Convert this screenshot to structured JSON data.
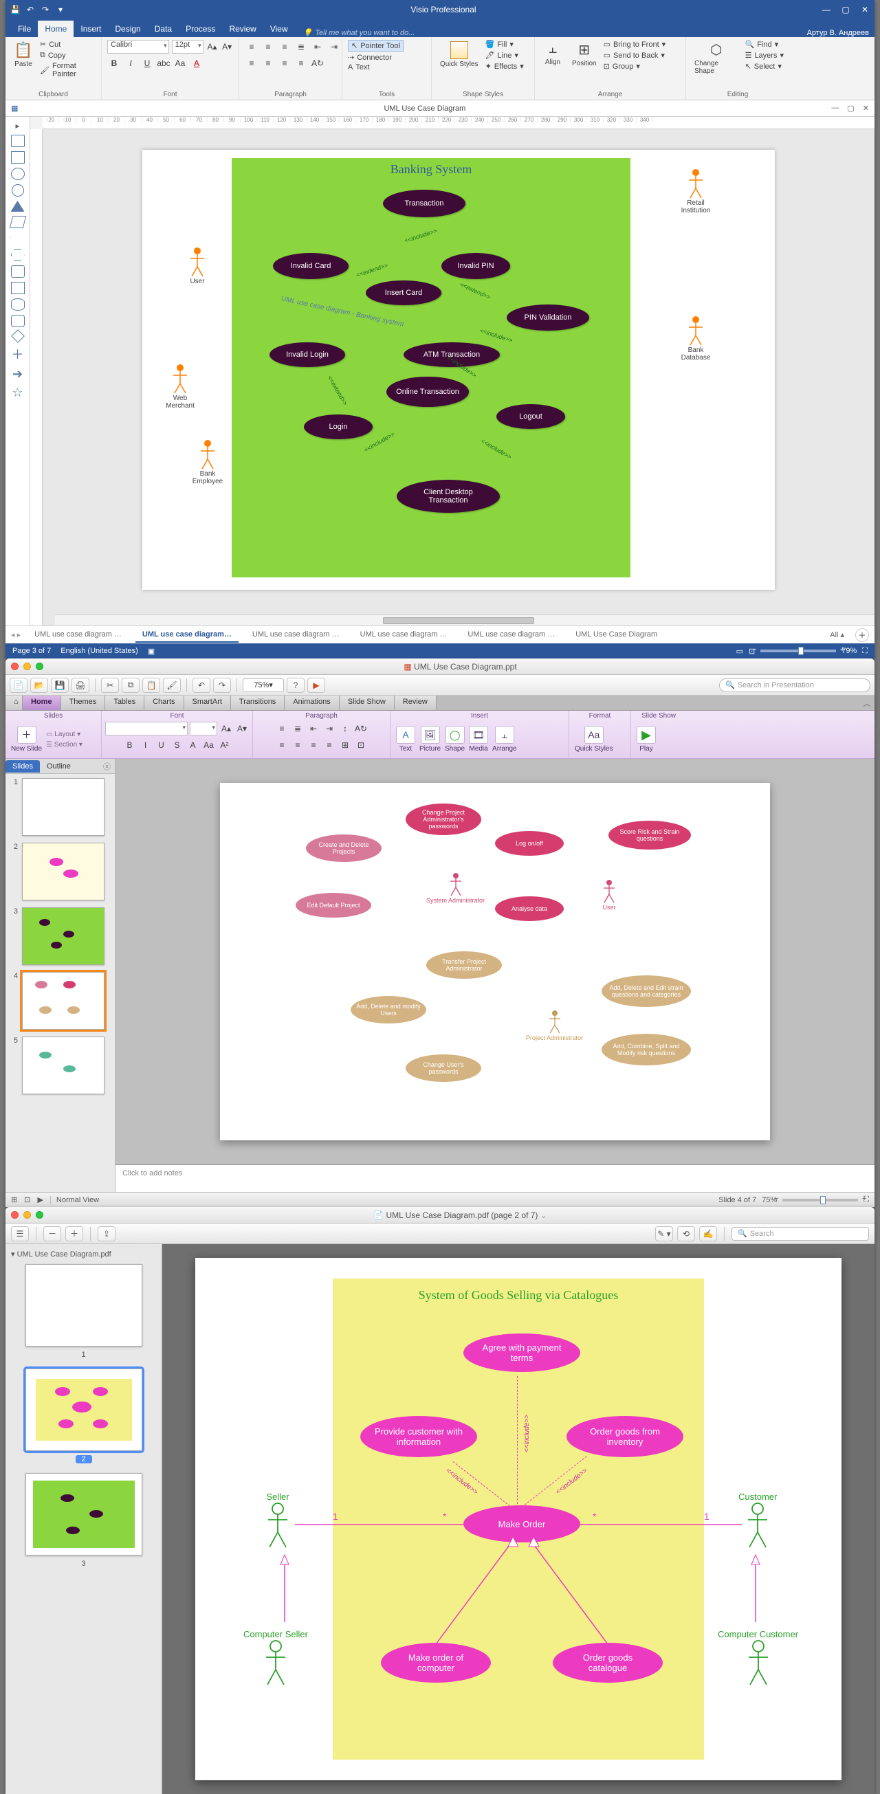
{
  "visio": {
    "title": "Visio Professional",
    "user": "Артур В. Андреев",
    "menu": [
      "File",
      "Home",
      "Insert",
      "Design",
      "Data",
      "Process",
      "Review",
      "View"
    ],
    "menu_active": 1,
    "tell_me": "Tell me what you want to do...",
    "clipboard": {
      "paste": "Paste",
      "cut": "Cut",
      "copy": "Copy",
      "fmt": "Format Painter",
      "label": "Clipboard"
    },
    "font": {
      "name": "Calibri",
      "size": "12pt",
      "label": "Font"
    },
    "paragraph_label": "Paragraph",
    "tools": {
      "pointer": "Pointer Tool",
      "connector": "Connector",
      "text": "Text",
      "label": "Tools"
    },
    "shapestyles_label": "Shape Styles",
    "shapestyles": {
      "fill": "Fill",
      "line": "Line",
      "effects": "Effects",
      "quick": "Quick Styles"
    },
    "arrange": {
      "align": "Align",
      "position": "Position",
      "front": "Bring to Front",
      "back": "Send to Back",
      "group": "Group",
      "label": "Arrange"
    },
    "editing": {
      "change": "Change Shape",
      "find": "Find",
      "layers": "Layers",
      "select": "Select",
      "label": "Editing"
    },
    "doc_title": "UML Use Case Diagram",
    "page_tabs": [
      "UML use case diagram …",
      "UML use case diagram…",
      "UML use case diagram …",
      "UML use case diagram …",
      "UML use case diagram …",
      "UML Use Case Diagram"
    ],
    "page_tabs_active": 1,
    "all": "All",
    "status_page": "Page 3 of 7",
    "status_lang": "English (United States)",
    "zoom": "79%",
    "diagram": {
      "system": "Banking System",
      "comment": "UML use case diagram - Banking system",
      "usecases": {
        "transaction": "Transaction",
        "invalid_card": "Invalid Card",
        "invalid_pin": "Invalid PIN",
        "insert_card": "Insert Card",
        "pin_validation": "PIN Validation",
        "atm": "ATM Transaction",
        "invalid_login": "Invalid Login",
        "online": "Online Transaction",
        "login": "Login",
        "logout": "Logout",
        "client_desktop": "Client Desktop Transaction"
      },
      "stereo_include": "<<include>>",
      "stereo_extend": "<<extend>>",
      "actors": {
        "user": "User",
        "web_merchant": "Web Merchant",
        "bank_employee": "Bank Employee",
        "retail": "Retail Institution",
        "bank_db": "Bank Database"
      }
    }
  },
  "ppt": {
    "title": "UML Use Case Diagram.ppt",
    "zoom": "75%",
    "search_ph": "Search in Presentation",
    "tabs": [
      "Home",
      "Themes",
      "Tables",
      "Charts",
      "SmartArt",
      "Transitions",
      "Animations",
      "Slide Show",
      "Review"
    ],
    "tabs_active": 0,
    "groups": {
      "slides": "Slides",
      "font": "Font",
      "paragraph": "Paragraph",
      "insert": "Insert",
      "format": "Format",
      "slideshow": "Slide Show"
    },
    "slides_btns": {
      "new": "New Slide",
      "layout": "Layout",
      "section": "Section"
    },
    "insert_btns": {
      "text": "Text",
      "picture": "Picture",
      "shape": "Shape",
      "media": "Media",
      "arrange": "Arrange"
    },
    "format_btn": "Quick Styles",
    "play": "Play",
    "side_tabs": {
      "slides": "Slides",
      "outline": "Outline"
    },
    "notes": "Click to add notes",
    "status_view": "Normal View",
    "status_slide": "Slide 4 of 7",
    "status_zoom": "75%",
    "slide_uc": {
      "change_pwd": "Change Project Administrator's passwords",
      "create_del": "Create and Delete Projects",
      "edit_default": "Edit Default Project",
      "logon": "Log on/off",
      "analyse": "Analyse data",
      "score": "Score Risk and Strain questions",
      "transfer": "Transfer Project Administrator",
      "add_users": "Add, Delete and modify Users",
      "change_user_pwd": "Change User's passwords",
      "add_strain": "Add, Delete and Edit strain questions and categories",
      "add_risk": "Add, Combine, Split and Modify risk questions"
    },
    "slide_actors": {
      "sysadmin": "System Administrator",
      "user": "User",
      "projadmin": "Project Administrator"
    }
  },
  "pdf": {
    "title": "UML Use Case Diagram.pdf (page 2 of 7)",
    "search_ph": "Search",
    "side_hdr": "UML Use Case Diagram.pdf",
    "thumbs": [
      "1",
      "2",
      "3"
    ],
    "thumb_sel": 1,
    "diagram": {
      "system": "System of Goods Selling via Catalogues",
      "usecases": {
        "agree": "Agree with payment terms",
        "provide": "Provide customer with information",
        "make_order": "Make Order",
        "order_inv": "Order goods from inventory",
        "make_comp": "Make order of computer",
        "order_cat": "Order goods catalogue"
      },
      "stereo_include": "<<include>>",
      "actors": {
        "seller": "Seller",
        "customer": "Customer",
        "comp_seller": "Computer Seller",
        "comp_customer": "Computer Customer"
      },
      "mult_one": "1",
      "mult_star": "*"
    }
  }
}
